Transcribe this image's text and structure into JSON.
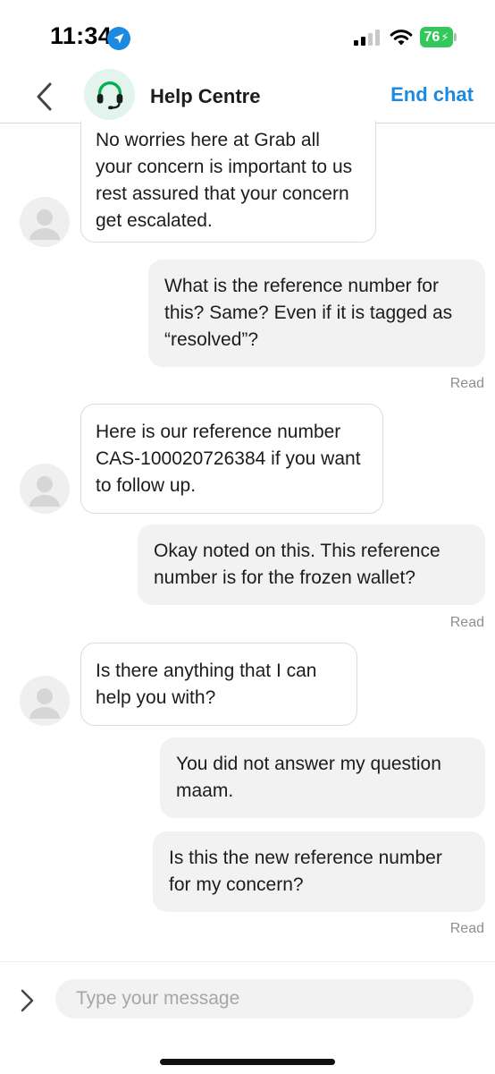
{
  "status_bar": {
    "time": "11:34",
    "battery_level": "76",
    "icons": [
      "location-arrow-icon",
      "signal-bars-icon",
      "wifi-icon",
      "battery-charging-icon"
    ]
  },
  "header": {
    "title": "Help Centre",
    "end_chat_label": "End chat",
    "back_icon": "chevron-left-icon",
    "avatar_icon": "headset-icon"
  },
  "messages": [
    {
      "sender": "agent",
      "text": "No worries here at Grab all your concern is important to us rest assured that your concern get escalated."
    },
    {
      "sender": "user",
      "text": "What is the reference number for this? Same? Even if it is tagged as “resolved”?",
      "status": "Read"
    },
    {
      "sender": "agent",
      "text": "Here is our reference number CAS-100020726384  if you want to follow up."
    },
    {
      "sender": "user",
      "text": "Okay noted on this. This reference number is for the frozen wallet?",
      "status": "Read"
    },
    {
      "sender": "agent",
      "text": "Is there anything that I can help you with?"
    },
    {
      "sender": "user",
      "text": "You did not answer my question maam."
    },
    {
      "sender": "user",
      "text": "Is this the new reference number for my concern?",
      "status": "Read"
    }
  ],
  "composer": {
    "placeholder": "Type your message",
    "value": "",
    "expand_icon": "chevron-right-icon"
  },
  "colors": {
    "accent": "#1c8ae0",
    "brand_green": "#00b14f",
    "battery_green": "#34c759",
    "outgoing_bubble": "#f2f2f2"
  }
}
